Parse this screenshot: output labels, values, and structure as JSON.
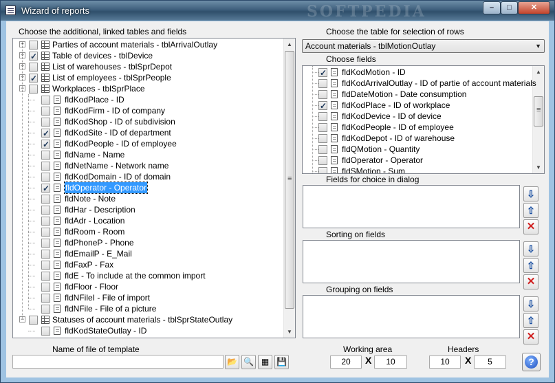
{
  "window": {
    "title": "Wizard of reports",
    "watermark": "SOFTPEDIA",
    "min_glyph": "–",
    "max_glyph": "□",
    "close_glyph": "✕"
  },
  "left": {
    "heading": "Choose the additional, linked tables and fields",
    "tree": [
      {
        "label": "Parties of account materials - tblArrivalOutlay",
        "type": "table",
        "checked": false,
        "expander": "+"
      },
      {
        "label": "Table of devices - tblDevice",
        "type": "table",
        "checked": true,
        "expander": "+"
      },
      {
        "label": "List of warehouses - tblSprDepot",
        "type": "table",
        "checked": false,
        "expander": "+"
      },
      {
        "label": "List of employees - tblSprPeople",
        "type": "table",
        "checked": true,
        "expander": "+"
      },
      {
        "label": "Workplaces - tblSprPlace",
        "type": "table",
        "checked": false,
        "expander": "−"
      },
      {
        "label": "fldKodPlace - ID",
        "type": "field",
        "checked": false
      },
      {
        "label": "fldKodFirm - ID of company",
        "type": "field",
        "checked": false
      },
      {
        "label": "fldKodShop - ID of subdivision",
        "type": "field",
        "checked": false
      },
      {
        "label": "fldKodSite - ID of department",
        "type": "field",
        "checked": true
      },
      {
        "label": "fldKodPeople - ID of employee",
        "type": "field",
        "checked": true
      },
      {
        "label": "fldName - Name",
        "type": "field",
        "checked": false
      },
      {
        "label": "fldNetName - Network name",
        "type": "field",
        "checked": false
      },
      {
        "label": "fldKodDomain - ID of domain",
        "type": "field",
        "checked": false
      },
      {
        "label": "fldOperator - Operator",
        "type": "field",
        "checked": true,
        "selected": true
      },
      {
        "label": "fldNote - Note",
        "type": "field",
        "checked": false
      },
      {
        "label": "fldHar - Description",
        "type": "field",
        "checked": false
      },
      {
        "label": "fldAdr - Location",
        "type": "field",
        "checked": false
      },
      {
        "label": "fldRoom - Room",
        "type": "field",
        "checked": false
      },
      {
        "label": "fldPhoneP - Phone",
        "type": "field",
        "checked": false
      },
      {
        "label": "fldEmailP - E_Mail",
        "type": "field",
        "checked": false
      },
      {
        "label": "fldFaxP - Fax",
        "type": "field",
        "checked": false
      },
      {
        "label": "fldE - To include at the common import",
        "type": "field",
        "checked": false
      },
      {
        "label": "fldFloor - Floor",
        "type": "field",
        "checked": false
      },
      {
        "label": "fldNFileI - File of import",
        "type": "field",
        "checked": false
      },
      {
        "label": "fldNFile - File of a picture",
        "type": "field",
        "checked": false
      },
      {
        "label": "Statuses of account materials - tblSprStateOutlay",
        "type": "table",
        "checked": false,
        "expander": "−"
      },
      {
        "label": "fldKodStateOutlay - ID",
        "type": "field",
        "checked": false
      }
    ],
    "template_label": "Name of file of template",
    "template_value": ""
  },
  "right": {
    "heading": "Choose the table for selection of rows",
    "table_select": "Account materials - tblMotionOutlay",
    "fields_label": "Choose fields",
    "fields": [
      {
        "label": "fldKodMotion - ID",
        "checked": true
      },
      {
        "label": "fldKodArrivalOutlay - ID of partie of account materials",
        "checked": false
      },
      {
        "label": "fldDateMotion - Date consumption",
        "checked": false
      },
      {
        "label": "fldKodPlace - ID of workplace",
        "checked": true
      },
      {
        "label": "fldKodDevice - ID of device",
        "checked": false
      },
      {
        "label": "fldKodPeople - ID of employee",
        "checked": false
      },
      {
        "label": "fldKodDepot - ID of warehouse",
        "checked": false
      },
      {
        "label": "fldQMotion - Quantity",
        "checked": false
      },
      {
        "label": "fldOperator - Operator",
        "checked": false
      },
      {
        "label": "fldSMotion - Sum",
        "checked": false
      }
    ],
    "dialog_label": "Fields for choice in dialog",
    "sorting_label": "Sorting on fields",
    "grouping_label": "Grouping on fields",
    "down_glyph": "⇩",
    "up_glyph": "⇧",
    "del_glyph": "✕"
  },
  "bottom": {
    "working_area_label": "Working area",
    "working_area_cols": "20",
    "working_area_rows": "10",
    "headers_label": "Headers",
    "headers_cols": "10",
    "headers_rows": "5",
    "times": "X",
    "help_glyph": "?",
    "open_glyph": "📂",
    "preview_glyph": "🔍",
    "edit_glyph": "▦",
    "save_glyph": "💾"
  },
  "colors": {
    "selection": "#3399ff",
    "delete": "#d02020",
    "arrow": "#1a4fa0"
  }
}
